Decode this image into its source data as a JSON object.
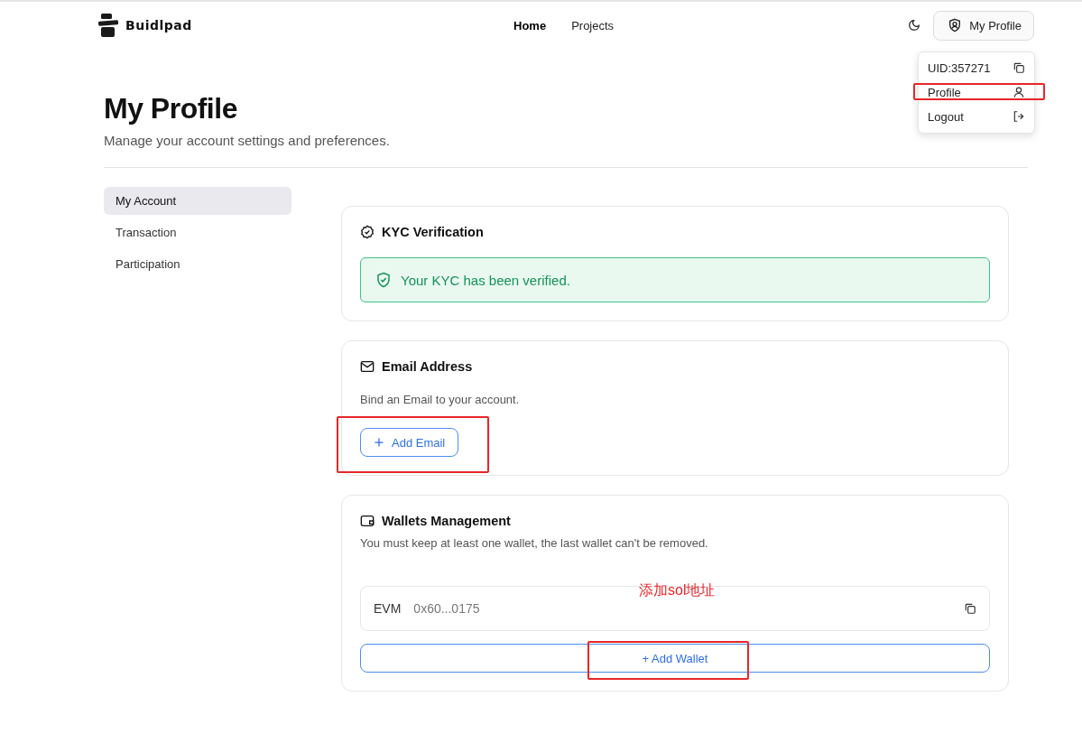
{
  "header": {
    "logo": "Buidlpad",
    "nav": [
      {
        "label": "Home",
        "selected": true
      },
      {
        "label": "Projects",
        "selected": false
      }
    ],
    "profile_button": "My Profile"
  },
  "profile_menu": {
    "expanded": true,
    "items": [
      {
        "kind": "uid",
        "label": "UID:357271",
        "highlighted": false
      },
      {
        "kind": "profile",
        "label": "Profile",
        "highlighted": true
      },
      {
        "kind": "logout",
        "label": "Logout",
        "highlighted": false
      }
    ]
  },
  "page": {
    "title": "My Profile",
    "subtitle": "Manage your account settings and preferences."
  },
  "sidebar": {
    "items": [
      {
        "label": "My Account",
        "selected": true
      },
      {
        "label": "Transaction",
        "selected": false
      },
      {
        "label": "Participation",
        "selected": false
      }
    ]
  },
  "kyc": {
    "title": "KYC Verification",
    "status": "Your KYC has been verified.",
    "verified": true
  },
  "email": {
    "title": "Email Address",
    "description": "Bind an Email to your account.",
    "add_button": {
      "label": "Add Email",
      "highlighted": true
    }
  },
  "wallets": {
    "title": "Wallets Management",
    "description": "You must keep at least one wallet, the last wallet can't be removed.",
    "items": [
      {
        "chain": "EVM",
        "address": "0x60...0175"
      }
    ],
    "add_button": {
      "label": "+ Add Wallet",
      "highlighted": true
    },
    "note": "添加sol地址"
  }
}
